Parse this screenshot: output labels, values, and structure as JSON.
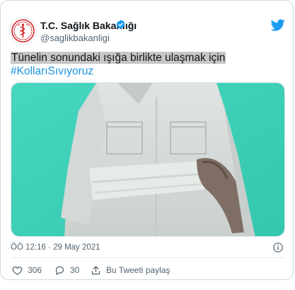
{
  "account": {
    "name": "T.C. Sağlık Bakanlığı",
    "handle": "@saglikbakanligi"
  },
  "tweet": {
    "text": "Tünelin sonundaki ışığa birlikte ulaşmak için",
    "hashtag": "#KollarıSıvıyoruz",
    "timestamp": "ÖÖ 12:16 · 29 May 2021"
  },
  "actions": {
    "likes": "306",
    "replies": "30",
    "share_label": "Bu Tweeti paylaş"
  },
  "colors": {
    "link": "#1b95e0",
    "video_background": "#3fd0b8",
    "verified": "#1d9bf0"
  },
  "icons": [
    "logo-icon",
    "verified-icon",
    "twitter-bird-icon",
    "info-icon",
    "heart-icon",
    "reply-icon",
    "share-icon"
  ]
}
